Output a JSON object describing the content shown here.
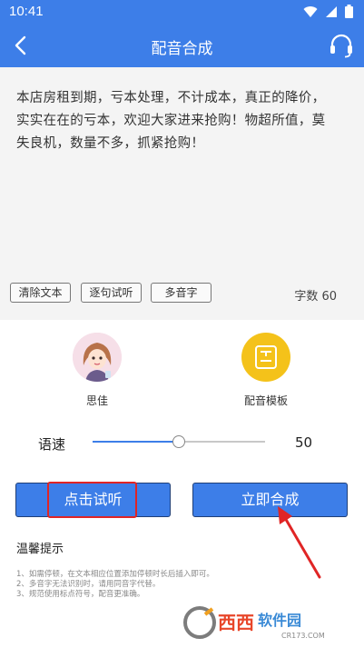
{
  "status_bar": {
    "time": "10:41"
  },
  "app_bar": {
    "title": "配音合成"
  },
  "editor": {
    "content_lines": [
      "本店房租到期，亏本处理，不计成本，真正的降价，",
      "实实在在的亏本，欢迎大家进来抢购！物超所值，莫",
      "失良机，数量不多，抓紧抢购！"
    ],
    "buttons": {
      "clear": "清除文本",
      "sentence_preview": "逐句试听",
      "polyphone": "多音字"
    },
    "word_count": "字数 60"
  },
  "voices": {
    "speaker_name": "思佳",
    "template_label": "配音模板"
  },
  "speed": {
    "label": "语速",
    "value": "50",
    "level_fraction": 0.5
  },
  "actions": {
    "preview": "点击试听",
    "synthesize": "立即合成"
  },
  "tips": {
    "title": "温馨提示",
    "items": [
      "1、如需停顿，在文本相应位置添加停顿时长后插入即可。",
      "2、多音字无法识别时，请用同音字代替。",
      "3、规范使用标点符号，配音更准确。"
    ]
  },
  "watermark": {
    "brand": "西西",
    "site": "软件园",
    "url": "CR173.COM"
  },
  "colors": {
    "primary": "#3d7ee8",
    "highlight": "#e02525",
    "template_icon": "#f4c21a"
  },
  "icons": [
    "back-arrow-icon",
    "headset-icon",
    "wifi-icon",
    "cellular-icon",
    "battery-icon",
    "template-icon"
  ]
}
